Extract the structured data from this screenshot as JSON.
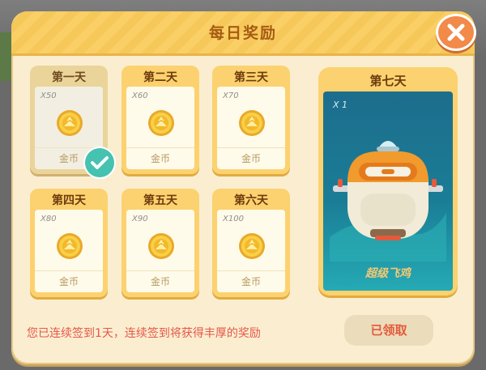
{
  "dialog": {
    "title": "每日奖励"
  },
  "days": [
    {
      "label": "第一天",
      "qty": "X50",
      "reward": "金币",
      "claimed": true
    },
    {
      "label": "第二天",
      "qty": "X60",
      "reward": "金币",
      "claimed": false
    },
    {
      "label": "第三天",
      "qty": "X70",
      "reward": "金币",
      "claimed": false
    },
    {
      "label": "第四天",
      "qty": "X80",
      "reward": "金币",
      "claimed": false
    },
    {
      "label": "第五天",
      "qty": "X90",
      "reward": "金币",
      "claimed": false
    },
    {
      "label": "第六天",
      "qty": "X100",
      "reward": "金币",
      "claimed": false
    }
  ],
  "grand_prize": {
    "label": "第七天",
    "qty": "X 1",
    "name": "超级飞鸡",
    "icon": "robot-chicken-icon"
  },
  "notice": "您已连续签到1天，连续签到将获得丰厚的奖励",
  "claim_button": "已领取",
  "icons": {
    "coin": "gold-coin-icon",
    "check": "check-icon",
    "close": "close-icon"
  },
  "colors": {
    "accent": "#f6c85a",
    "notice": "#e5574a",
    "check": "#45c2b0"
  }
}
